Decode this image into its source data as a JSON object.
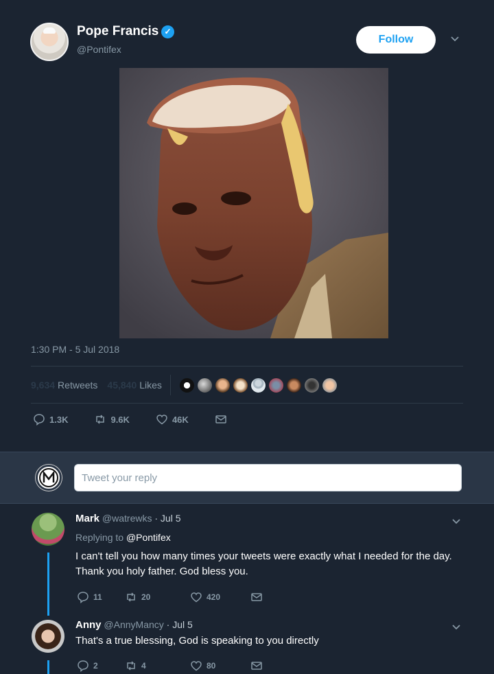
{
  "tweet": {
    "display_name": "Pope Francis",
    "verified_icon": "verified-check-icon",
    "handle": "@Pontifex",
    "follow_label": "Follow",
    "timestamp": "1:30 PM - 5 Jul 2018",
    "retweets_count": "9,634",
    "retweets_label": "Retweets",
    "likes_count": "45,840",
    "likes_label": "Likes",
    "actions": {
      "reply_count": "1.3K",
      "retweet_count": "9.6K",
      "like_count": "46K"
    }
  },
  "compose": {
    "placeholder": "Tweet your reply"
  },
  "replies": [
    {
      "name": "Mark",
      "handle": "@watrewks",
      "date": "· Jul 5",
      "replying_prefix": "Replying to",
      "replying_to": "@Pontifex",
      "text": "I can't tell you how many times your tweets were exactly what I needed for the day. Thank you holy father. God bless you.",
      "reply_count": "11",
      "retweet_count": "20",
      "like_count": "420"
    },
    {
      "name": "Anny",
      "handle": "@AnnyMancy",
      "date": "· Jul 5",
      "text": "That's a true blessing, God is speaking to you directly",
      "reply_count": "2",
      "retweet_count": "4",
      "like_count": "80"
    }
  ],
  "colors": {
    "background": "#1b2431",
    "accent": "#1da1f2",
    "muted": "#8899a6"
  }
}
